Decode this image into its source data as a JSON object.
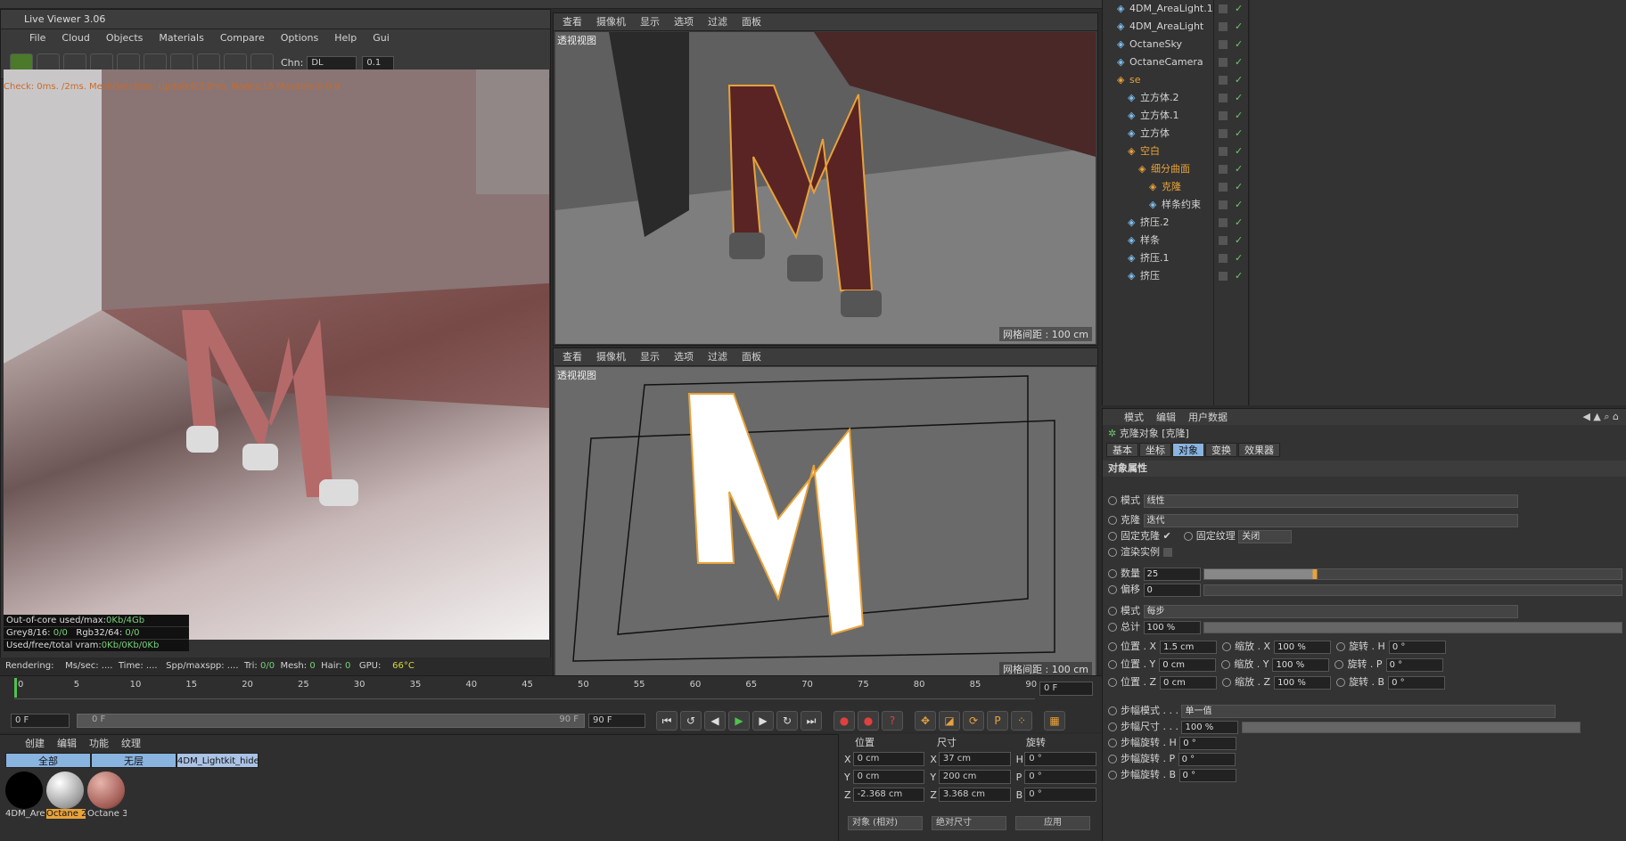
{
  "live_viewer": {
    "title": "Live Viewer 3.06",
    "menu": [
      "File",
      "Cloud",
      "Objects",
      "Materials",
      "Compare",
      "Options",
      "Help",
      "Gui"
    ],
    "channel_label": "Chn:",
    "channel_value": "DL",
    "gamma_value": "0.1",
    "status_line": "Check: 0ms. /2ms. MeshGen:0ms. Update[C]:0ms. Nodes:15 Movable:0  0 0",
    "stats": {
      "outofcore": "Out-of-core used/max:",
      "outofcore_val": "0Kb/4Gb",
      "grey": "Grey8/16:",
      "grey_val": "0/0",
      "rgb": "Rgb32/64:",
      "rgb_val": "0/0",
      "vram": "Used/free/total vram:",
      "vram_val": "0Kb/0Kb/0Kb"
    },
    "rendering_line": {
      "rendering": "Rendering:",
      "ms": "Ms/sec: ....",
      "time": "Time: ....",
      "spp": "Spp/maxspp: ....",
      "tri_label": "Tri:",
      "tri": "0/0",
      "mesh_label": "Mesh:",
      "mesh": "0",
      "hair_label": "Hair:",
      "hair": "0",
      "gpu_label": "GPU:",
      "gpu": "66°C"
    }
  },
  "viewport_top": {
    "menu": [
      "查看",
      "摄像机",
      "显示",
      "选项",
      "过滤",
      "面板"
    ],
    "label": "透视视图",
    "grid": "网格间距 : 100 cm"
  },
  "viewport_bottom": {
    "menu": [
      "查看",
      "摄像机",
      "显示",
      "选项",
      "过滤",
      "面板"
    ],
    "label": "透视视图",
    "grid": "网格间距 : 100 cm"
  },
  "timeline": {
    "ticks": [
      "0",
      "5",
      "10",
      "15",
      "20",
      "25",
      "30",
      "35",
      "40",
      "45",
      "50",
      "55",
      "60",
      "65",
      "70",
      "75",
      "80",
      "85",
      "90"
    ],
    "current_frame": "0 F",
    "start": "0 F",
    "range_start": "0 F",
    "range_end": "90 F",
    "end": "90 F"
  },
  "materials": {
    "menu": [
      "创建",
      "编辑",
      "功能",
      "纹理"
    ],
    "layers": [
      "全部",
      "无层",
      "4DM_Lightkit_hide"
    ],
    "items": [
      {
        "name": "4DM_Are",
        "color": "#000000"
      },
      {
        "name": "Octane 2",
        "color": "#c8c8c8"
      },
      {
        "name": "Octane 3",
        "color": "#b06a60"
      }
    ]
  },
  "coords": {
    "headers": [
      "位置",
      "尺寸",
      "旋转"
    ],
    "rows": [
      {
        "axis": "X",
        "pos": "0 cm",
        "size_axis": "X",
        "size": "37 cm",
        "rot_axis": "H",
        "rot": "0 °"
      },
      {
        "axis": "Y",
        "pos": "0 cm",
        "size_axis": "Y",
        "size": "200 cm",
        "rot_axis": "P",
        "rot": "0 °"
      },
      {
        "axis": "Z",
        "pos": "-2.368 cm",
        "size_axis": "Z",
        "size": "3.368 cm",
        "rot_axis": "B",
        "rot": "0 °"
      }
    ],
    "mode_select": "对象 (相对)",
    "size_select": "绝对尺寸",
    "apply": "应用"
  },
  "object_manager": {
    "rows": [
      {
        "name": "4DM_AreaLight.1",
        "indent": 0,
        "orange": false
      },
      {
        "name": "4DM_AreaLight",
        "indent": 0,
        "orange": false
      },
      {
        "name": "OctaneSky",
        "indent": 0,
        "orange": false
      },
      {
        "name": "OctaneCamera",
        "indent": 0,
        "orange": false
      },
      {
        "name": "se",
        "indent": 0,
        "orange": true
      },
      {
        "name": "立方体.2",
        "indent": 1,
        "orange": false
      },
      {
        "name": "立方体.1",
        "indent": 1,
        "orange": false
      },
      {
        "name": "立方体",
        "indent": 1,
        "orange": false
      },
      {
        "name": "空白",
        "indent": 1,
        "orange": true
      },
      {
        "name": "细分曲面",
        "indent": 2,
        "orange": true
      },
      {
        "name": "克隆",
        "indent": 3,
        "orange": true
      },
      {
        "name": "样条约束",
        "indent": 3,
        "orange": false
      },
      {
        "name": "挤压.2",
        "indent": 1,
        "orange": false
      },
      {
        "name": "样条",
        "indent": 1,
        "orange": false
      },
      {
        "name": "挤压.1",
        "indent": 1,
        "orange": false
      },
      {
        "name": "挤压",
        "indent": 1,
        "orange": false
      }
    ]
  },
  "attributes": {
    "menu": [
      "模式",
      "编辑",
      "用户数据"
    ],
    "object_title": "克隆对象 [克隆]",
    "tabs": [
      "基本",
      "坐标",
      "对象",
      "变换",
      "效果器"
    ],
    "section": "对象属性",
    "mode_label": "模式",
    "mode_value": "线性",
    "clone_label": "克隆",
    "clone_value": "迭代",
    "fix_clone": "固定克隆",
    "fix_texture": "固定纹理",
    "fix_texture_value": "关闭",
    "render_instance": "渲染实例",
    "count_label": "数量",
    "count_value": "25",
    "offset_label": "偏移",
    "offset_value": "0",
    "mode2_label": "模式",
    "mode2_value": "每步",
    "total_label": "总计",
    "total_value": "100 %",
    "transforms": [
      {
        "pos_label": "位置 . X",
        "pos": "1.5 cm",
        "scale_label": "缩放 . X",
        "scale": "100 %",
        "rot_label": "旋转 . H",
        "rot": "0 °"
      },
      {
        "pos_label": "位置 . Y",
        "pos": "0 cm",
        "scale_label": "缩放 . Y",
        "scale": "100 %",
        "rot_label": "旋转 . P",
        "rot": "0 °"
      },
      {
        "pos_label": "位置 . Z",
        "pos": "0 cm",
        "scale_label": "缩放 . Z",
        "scale": "100 %",
        "rot_label": "旋转 . B",
        "rot": "0 °"
      }
    ],
    "step_mode_label": "步幅模式 . . .",
    "step_mode_value": "单一值",
    "step_size_label": "步幅尺寸 . . .",
    "step_size_value": "100 %",
    "step_rot_h_label": "步幅旋转 . H",
    "step_rot_h": "0 °",
    "step_rot_p_label": "步幅旋转 . P",
    "step_rot_p": "0 °",
    "step_rot_b_label": "步幅旋转 . B",
    "step_rot_b": "0 °"
  }
}
